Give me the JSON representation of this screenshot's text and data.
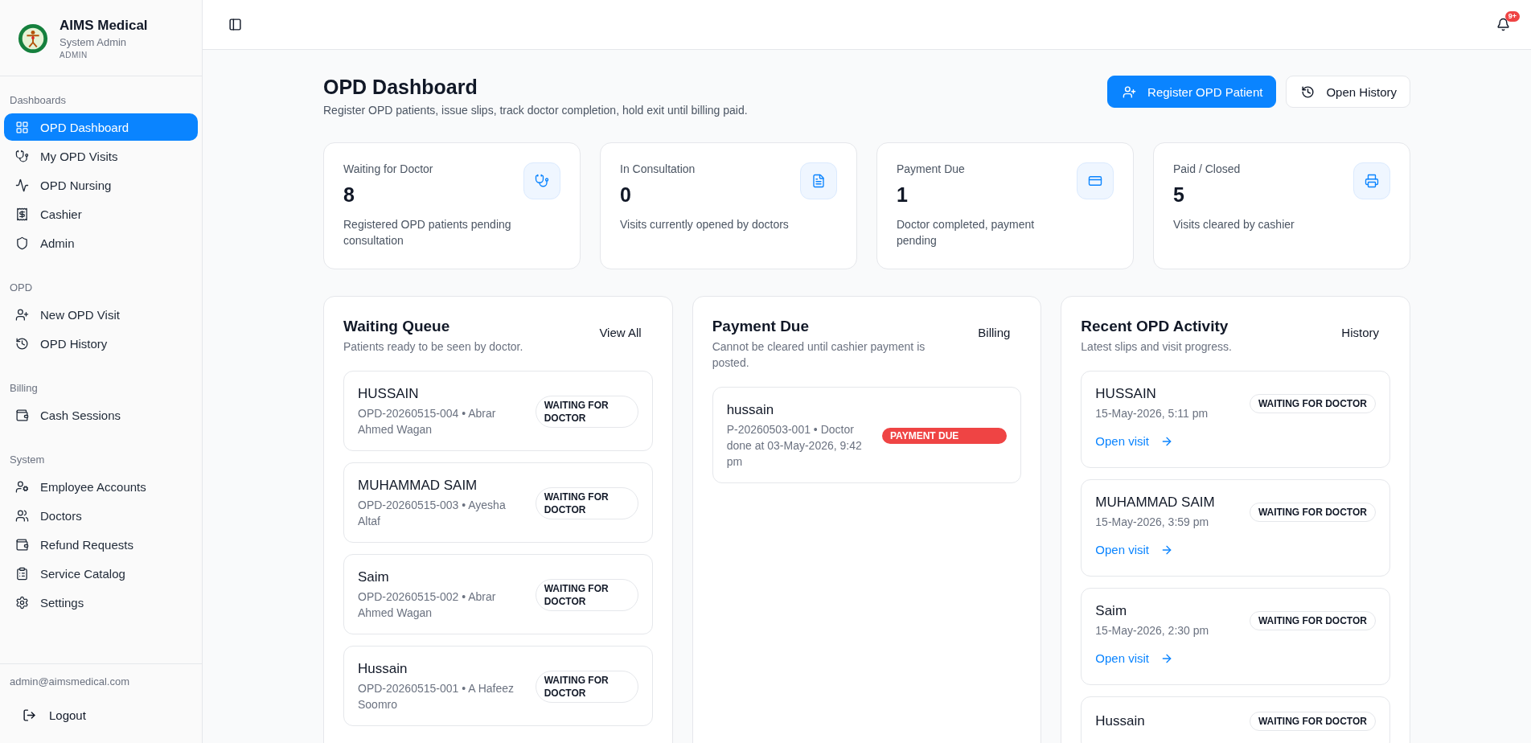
{
  "sidebar": {
    "brand": {
      "name": "AIMS Medical",
      "role": "System Admin",
      "tag": "ADMIN"
    },
    "sections": [
      {
        "title": "Dashboards",
        "items": [
          {
            "label": "OPD Dashboard",
            "selected": true
          },
          {
            "label": "My OPD Visits",
            "selected": false
          },
          {
            "label": "OPD Nursing",
            "selected": false
          },
          {
            "label": "Cashier",
            "selected": false
          },
          {
            "label": "Admin",
            "selected": false
          }
        ]
      },
      {
        "title": "OPD",
        "items": [
          {
            "label": "New OPD Visit",
            "selected": false
          },
          {
            "label": "OPD History",
            "selected": false
          }
        ]
      },
      {
        "title": "Billing",
        "items": [
          {
            "label": "Cash Sessions",
            "selected": false
          }
        ]
      },
      {
        "title": "System",
        "items": [
          {
            "label": "Employee Accounts",
            "selected": false
          },
          {
            "label": "Doctors",
            "selected": false
          },
          {
            "label": "Refund Requests",
            "selected": false
          },
          {
            "label": "Service Catalog",
            "selected": false
          },
          {
            "label": "Settings",
            "selected": false
          }
        ]
      }
    ],
    "user_email": "admin@aimsmedical.com",
    "logout": "Logout"
  },
  "topbar": {
    "notification_count": "9+"
  },
  "page": {
    "title": "OPD Dashboard",
    "subtitle": "Register OPD patients, issue slips, track doctor completion, hold exit until billing paid.",
    "primary_action": "Register OPD Patient",
    "secondary_action": "Open History"
  },
  "stats": [
    {
      "label": "Waiting for Doctor",
      "value": "8",
      "caption": "Registered OPD patients pending consultation"
    },
    {
      "label": "In Consultation",
      "value": "0",
      "caption": "Visits currently opened by doctors"
    },
    {
      "label": "Payment Due",
      "value": "1",
      "caption": "Doctor completed, payment pending"
    },
    {
      "label": "Paid / Closed",
      "value": "5",
      "caption": "Visits cleared by cashier"
    }
  ],
  "panels": [
    {
      "title": "Waiting Queue",
      "subtitle": "Patients ready to be seen by doctor.",
      "action": "View All",
      "items": [
        {
          "name": "HUSSAIN",
          "meta": "OPD-20260515-004 • Abrar Ahmed Wagan",
          "status": {
            "label": "WAITING FOR DOCTOR",
            "kind": "waiting"
          }
        },
        {
          "name": "MUHAMMAD SAIM",
          "meta": "OPD-20260515-003 • Ayesha Altaf",
          "status": {
            "label": "WAITING FOR DOCTOR",
            "kind": "waiting"
          }
        },
        {
          "name": "Saim",
          "meta": "OPD-20260515-002 • Abrar Ahmed Wagan",
          "status": {
            "label": "WAITING FOR DOCTOR",
            "kind": "waiting"
          }
        },
        {
          "name": "Hussain",
          "meta": "OPD-20260515-001 • A Hafeez Soomro",
          "status": {
            "label": "WAITING FOR DOCTOR",
            "kind": "waiting"
          }
        }
      ]
    },
    {
      "title": "Payment Due",
      "subtitle": "Cannot be cleared until cashier payment is posted.",
      "action": "Billing",
      "items": [
        {
          "name": "hussain",
          "meta": "P-20260503-001 • Doctor done at 03-May-2026, 9:42 pm",
          "status": {
            "label": "PAYMENT DUE",
            "kind": "payment_due"
          }
        }
      ]
    },
    {
      "title": "Recent OPD Activity",
      "subtitle": "Latest slips and visit progress.",
      "action": "History",
      "items": [
        {
          "name": "HUSSAIN",
          "meta": "15-May-2026, 5:11 pm",
          "status": {
            "label": "WAITING FOR DOCTOR",
            "kind": "waiting"
          },
          "link": "Open visit"
        },
        {
          "name": "MUHAMMAD SAIM",
          "meta": "15-May-2026, 3:59 pm",
          "status": {
            "label": "WAITING FOR DOCTOR",
            "kind": "waiting"
          },
          "link": "Open visit"
        },
        {
          "name": "Saim",
          "meta": "15-May-2026, 2:30 pm",
          "status": {
            "label": "WAITING FOR DOCTOR",
            "kind": "waiting"
          },
          "link": "Open visit"
        },
        {
          "name": "Hussain",
          "status": {
            "label": "WAITING FOR DOCTOR",
            "kind": "waiting"
          }
        }
      ]
    }
  ]
}
